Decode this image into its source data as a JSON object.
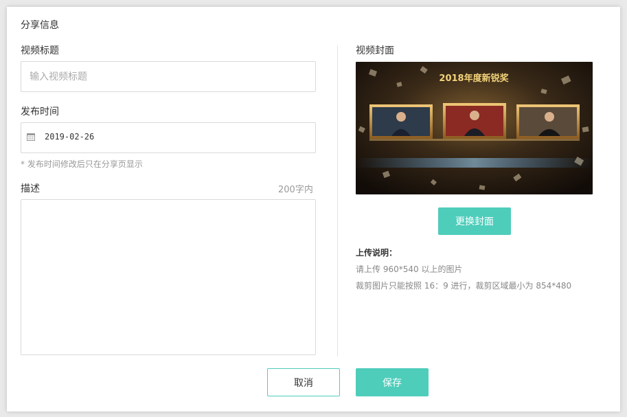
{
  "dialog": {
    "title": "分享信息"
  },
  "video_title": {
    "label": "视频标题",
    "placeholder": "输入视频标题",
    "value": ""
  },
  "publish_time": {
    "label": "发布时间",
    "value": "2019-02-26",
    "hint": "* 发布时间修改后只在分享页显示"
  },
  "description": {
    "label": "描述",
    "limit": "200字内",
    "value": ""
  },
  "cover": {
    "label": "视频封面",
    "image_banner_text": "2018年度新锐奖",
    "change_button": "更换封面"
  },
  "upload_notes": {
    "title": "上传说明：",
    "lines": [
      "请上传 960*540 以上的图片",
      "裁剪图片只能按照 16：9 进行，裁剪区域最小为 854*480"
    ]
  },
  "footer": {
    "cancel_label": "取消",
    "save_label": "保存"
  },
  "colors": {
    "accent": "#4ecdbb",
    "border": "#d9d9d9"
  }
}
